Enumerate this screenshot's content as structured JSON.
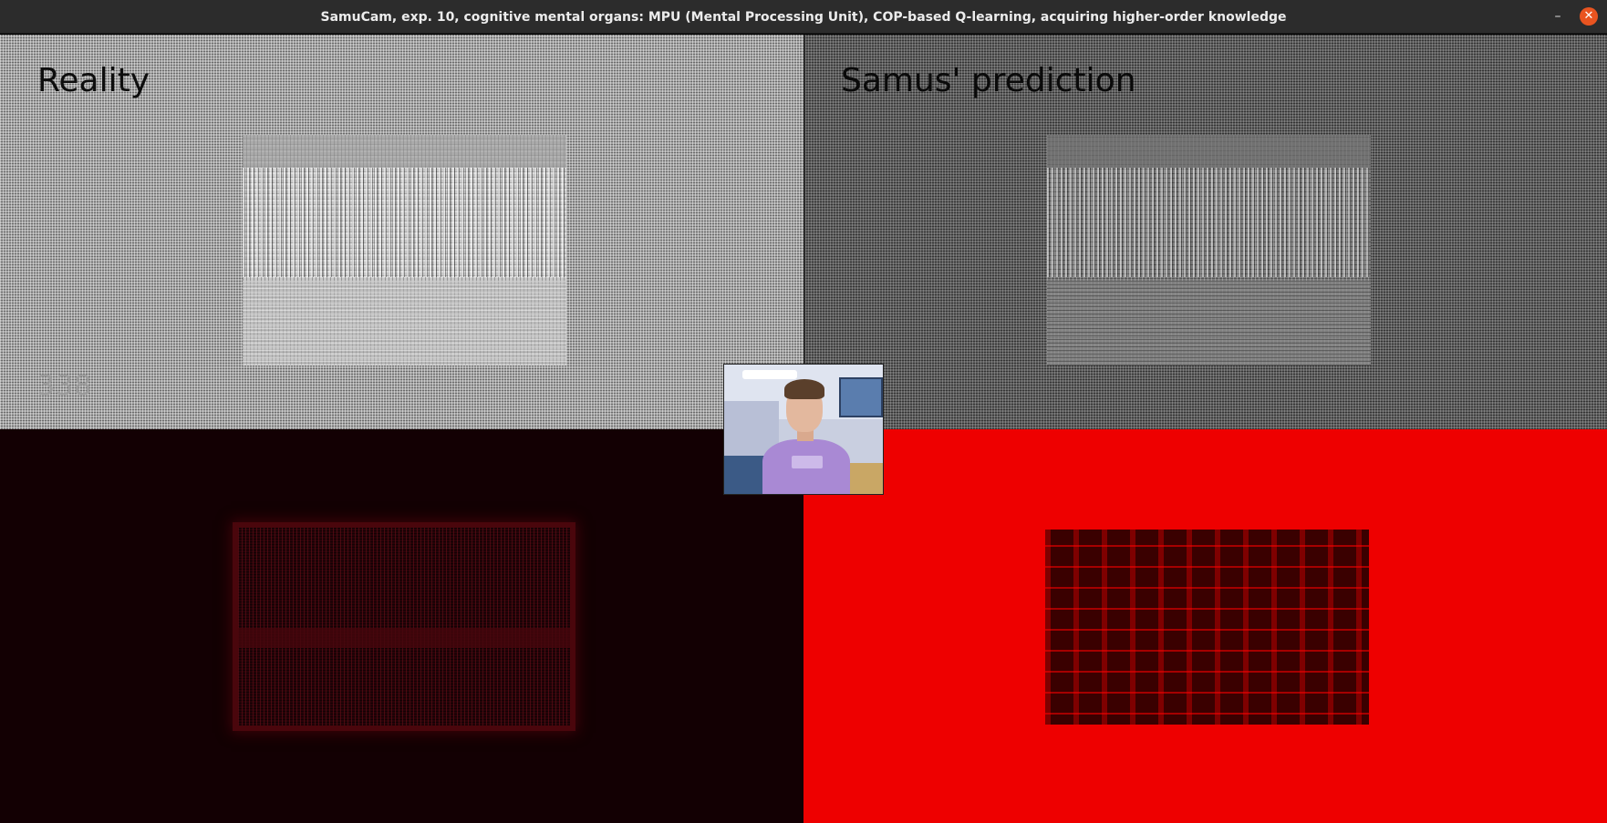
{
  "window": {
    "title": "SamuCam, exp. 10, cognitive mental organs: MPU (Mental Processing Unit), COP-based Q-learning, acquiring higher-order knowledge",
    "minimize_glyph": "–",
    "close_glyph": "✕"
  },
  "panels": {
    "reality": {
      "label": "Reality",
      "counter": "338"
    },
    "prediction": {
      "label": "Samus' prediction"
    }
  },
  "colors": {
    "titlebar": "#2c2c2c",
    "close_button": "#e95420",
    "error_background": "#130003",
    "binary_background": "#ee0000"
  },
  "icons": {
    "minimize": "minimize-icon",
    "close": "close-icon"
  }
}
